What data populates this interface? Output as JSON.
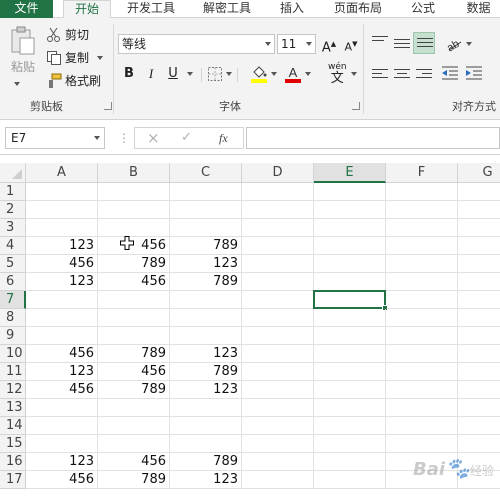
{
  "tabs": [
    {
      "label": "文件"
    },
    {
      "label": "开始"
    },
    {
      "label": "开发工具"
    },
    {
      "label": "解密工具"
    },
    {
      "label": "插入"
    },
    {
      "label": "页面布局"
    },
    {
      "label": "公式"
    },
    {
      "label": "数据"
    }
  ],
  "clipboard": {
    "paste_label": "粘贴",
    "cut_label": "剪切",
    "copy_label": "复制",
    "format_painter_label": "格式刷",
    "group_label": "剪贴板"
  },
  "font": {
    "font_name": "等线",
    "font_size": "11",
    "bold": "B",
    "italic": "I",
    "underline": "U",
    "phonetic": "wén",
    "group_label": "字体"
  },
  "alignment": {
    "group_label": "对齐方式"
  },
  "formula_bar": {
    "name_box": "E7",
    "cancel": "×",
    "enter": "✓",
    "fx": "fx",
    "value": ""
  },
  "grid": {
    "columns": [
      "A",
      "B",
      "C",
      "D",
      "E",
      "F",
      "G"
    ],
    "selected_column": "E",
    "selected_row": 7,
    "rows": [
      {
        "n": "1",
        "a": "",
        "b": "",
        "c": ""
      },
      {
        "n": "2",
        "a": "",
        "b": "",
        "c": ""
      },
      {
        "n": "3",
        "a": "",
        "b": "",
        "c": ""
      },
      {
        "n": "4",
        "a": "123",
        "b": "456",
        "c": "789"
      },
      {
        "n": "5",
        "a": "456",
        "b": "789",
        "c": "123"
      },
      {
        "n": "6",
        "a": "123",
        "b": "456",
        "c": "789"
      },
      {
        "n": "7",
        "a": "",
        "b": "",
        "c": ""
      },
      {
        "n": "8",
        "a": "",
        "b": "",
        "c": ""
      },
      {
        "n": "9",
        "a": "",
        "b": "",
        "c": ""
      },
      {
        "n": "10",
        "a": "456",
        "b": "789",
        "c": "123"
      },
      {
        "n": "11",
        "a": "123",
        "b": "456",
        "c": "789"
      },
      {
        "n": "12",
        "a": "456",
        "b": "789",
        "c": "123"
      },
      {
        "n": "13",
        "a": "",
        "b": "",
        "c": ""
      },
      {
        "n": "14",
        "a": "",
        "b": "",
        "c": ""
      },
      {
        "n": "15",
        "a": "",
        "b": "",
        "c": ""
      },
      {
        "n": "16",
        "a": "123",
        "b": "456",
        "c": "789"
      },
      {
        "n": "17",
        "a": "456",
        "b": "789",
        "c": "123"
      }
    ]
  },
  "watermark": {
    "text": "Bai",
    "suffix": "经验"
  },
  "colors": {
    "accent": "#217346",
    "ribbon_bg": "#f3f3f3",
    "grid_line": "#e1e1e1"
  }
}
